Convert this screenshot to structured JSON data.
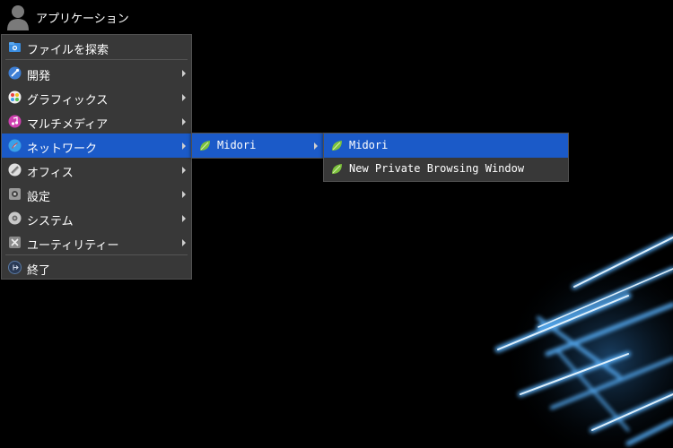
{
  "panel": {
    "title": "アプリケーション"
  },
  "menu": {
    "search_label": "ファイルを探索",
    "items": [
      {
        "label": "開発",
        "icon": "development-icon"
      },
      {
        "label": "グラフィックス",
        "icon": "graphics-icon"
      },
      {
        "label": "マルチメディア",
        "icon": "multimedia-icon"
      },
      {
        "label": "ネットワーク",
        "icon": "network-icon"
      },
      {
        "label": "オフィス",
        "icon": "office-icon"
      },
      {
        "label": "設定",
        "icon": "settings-icon"
      },
      {
        "label": "システム",
        "icon": "system-icon"
      },
      {
        "label": "ユーティリティー",
        "icon": "utilities-icon"
      }
    ],
    "quit_label": "終了"
  },
  "submenu_network": {
    "items": [
      {
        "label": "Midori",
        "icon": "midori-icon"
      }
    ]
  },
  "submenu_midori": {
    "items": [
      {
        "label": "Midori",
        "icon": "midori-icon"
      },
      {
        "label": "New Private Browsing Window",
        "icon": "midori-icon"
      }
    ]
  },
  "colors": {
    "menu_bg": "#383838",
    "highlight": "#1b5ac8",
    "wallpaper_glow": "#5ab4ff"
  }
}
